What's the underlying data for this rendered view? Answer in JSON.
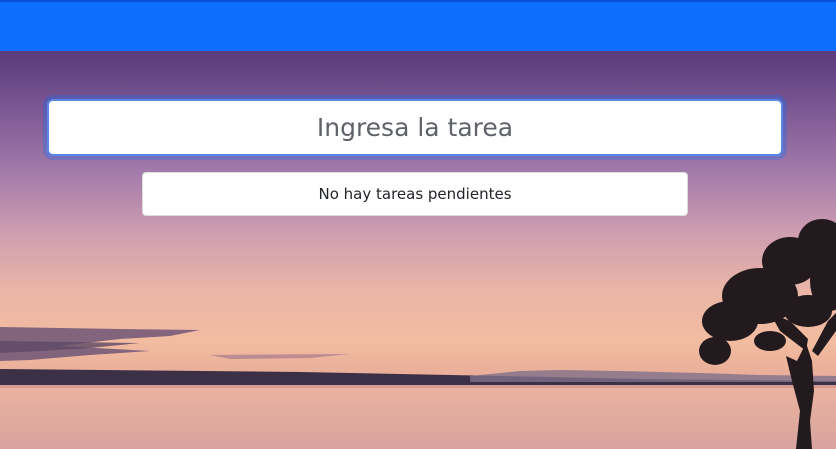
{
  "colors": {
    "navbar": "#0d6efd",
    "input_focus_border": "#5a86e6",
    "card_background": "#ffffff"
  },
  "task_form": {
    "placeholder": "Ingresa la tarea"
  },
  "task_list": {
    "empty_message": "No hay tareas pendientes"
  },
  "background": {
    "icon": "sunset-lake-photo"
  }
}
